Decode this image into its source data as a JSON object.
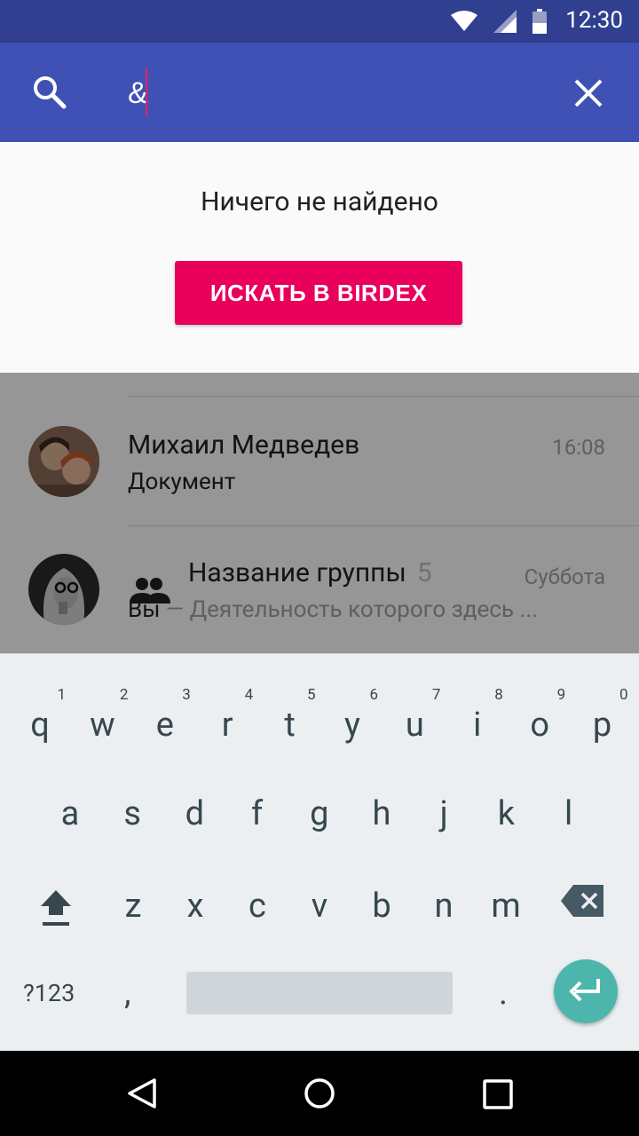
{
  "status_bar": {
    "time": "12:30"
  },
  "search_bar": {
    "query": "&"
  },
  "empty_state": {
    "message": "Ничего не найдено",
    "button_label": "ИСКАТЬ В BIRDEX"
  },
  "chats": [
    {
      "name": "Михаил Медведев",
      "time": "16:08",
      "sender": "",
      "preview": "Документ"
    },
    {
      "name": "Название группы",
      "count": "5",
      "time": "Суббота",
      "sender": "Вы",
      "preview": " — Деятельность которого здесь ..."
    }
  ],
  "keyboard": {
    "row1": [
      {
        "ch": "q",
        "num": "1"
      },
      {
        "ch": "w",
        "num": "2"
      },
      {
        "ch": "e",
        "num": "3"
      },
      {
        "ch": "r",
        "num": "4"
      },
      {
        "ch": "t",
        "num": "5"
      },
      {
        "ch": "y",
        "num": "6"
      },
      {
        "ch": "u",
        "num": "7"
      },
      {
        "ch": "i",
        "num": "8"
      },
      {
        "ch": "o",
        "num": "9"
      },
      {
        "ch": "p",
        "num": "0"
      }
    ],
    "row2": [
      "a",
      "s",
      "d",
      "f",
      "g",
      "h",
      "j",
      "k",
      "l"
    ],
    "row3": [
      "z",
      "x",
      "c",
      "v",
      "b",
      "n",
      "m"
    ],
    "symbols_label": "?123",
    "comma": ",",
    "period": "."
  },
  "colors": {
    "status_bar": "#303f8f",
    "app_bar": "#3f51b5",
    "accent": "#e8005a",
    "enter_key": "#4db6ac"
  }
}
